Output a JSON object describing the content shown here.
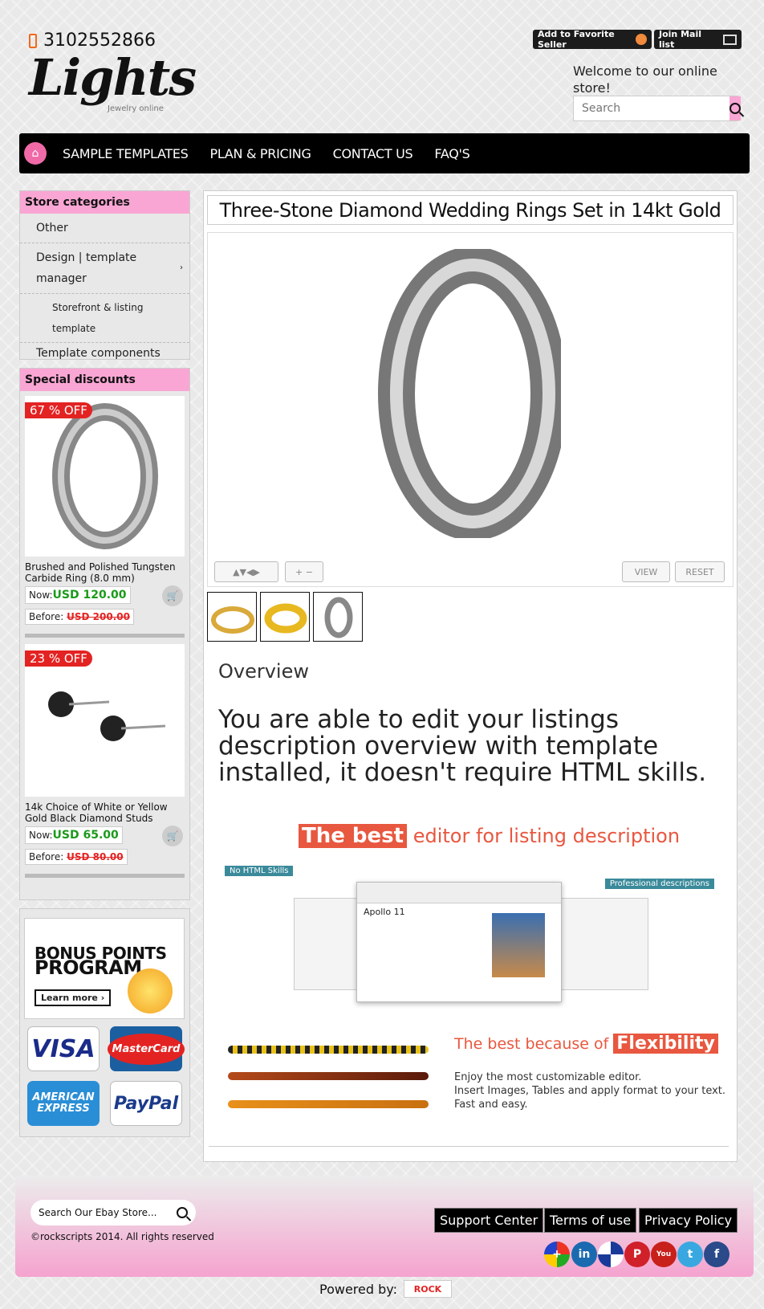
{
  "header": {
    "phone": "3102552866",
    "logo": "Lights",
    "logo_sub": "Jewelry online",
    "fav_button": "Add to Favorite Seller",
    "mail_button": "Join Mail list",
    "welcome": "Welcome to our online store!",
    "search_placeholder": "Search"
  },
  "nav": {
    "items": [
      "SAMPLE TEMPLATES",
      "PLAN & PRICING",
      "CONTACT US",
      "FAQ'S"
    ]
  },
  "categories": {
    "title": "Store categories",
    "items": [
      "Other",
      "Design | template manager"
    ],
    "sub": "Storefront & listing template",
    "last": "Template components"
  },
  "discounts": {
    "title": "Special discounts",
    "products": [
      {
        "off": "67 % OFF",
        "name": "Brushed and Polished Tungsten Carbide Ring (8.0 mm)",
        "now_label": "Now:",
        "now": "USD 120.00",
        "before_label": "Before:",
        "before": "USD 200.00"
      },
      {
        "off": "23 % OFF",
        "name": "14k Choice of White or Yellow Gold Black Diamond Studs",
        "now_label": "Now:",
        "now": "USD 65.00",
        "before_label": "Before:",
        "before": "USD 80.00"
      }
    ]
  },
  "bonus": {
    "title1": "BONUS POINTS",
    "title2": "PROGRAM",
    "learn": "Learn more ›"
  },
  "payments": {
    "visa": "VISA",
    "mastercard": "MasterCard",
    "amex1": "AMERICAN",
    "amex2": "EXPRESS",
    "paypal": "PayPal"
  },
  "main": {
    "title": "Three-Stone Diamond Wedding Rings Set in 14kt Gold",
    "view": "VIEW",
    "reset": "RESET",
    "overview": "Overview",
    "description": "You are able to edit your listings description overview with template installed, it doesn't require HTML skills.",
    "best_hl": "The best",
    "best_rest": " editor for listing description",
    "no_html": "No HTML Skills",
    "prof": "Professional descriptions",
    "apollo": "Apollo 11",
    "flex_pre": "The best because of ",
    "flex_hl": "Flexibility",
    "flex_desc": [
      "Enjoy the most customizable editor.",
      "Insert Images, Tables and apply format to your text.",
      "Fast and easy."
    ]
  },
  "footer": {
    "search_placeholder": "Search Our Ebay Store...",
    "copyright": "©rockscripts 2014. All rights reserved",
    "links": [
      "Support Center",
      "Terms of use",
      "Privacy Policy"
    ],
    "powered": "Powered by:",
    "brand": "ROCK"
  },
  "colors": {
    "accent": "#f9a6d4",
    "sale": "#e32322",
    "price": "#1a9a1a",
    "orange": "#e8573f"
  }
}
